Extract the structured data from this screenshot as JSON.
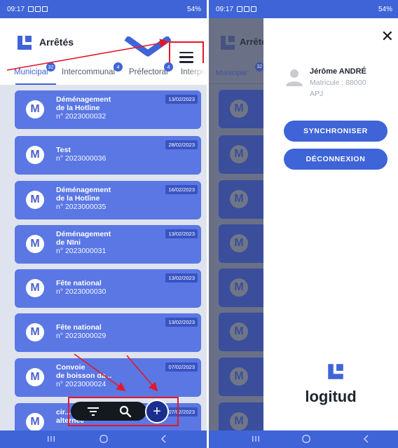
{
  "status_bar": {
    "time": "09:17",
    "battery": "54%"
  },
  "app": {
    "title": "Arrêtés",
    "menu_icon": "hamburger-menu-icon"
  },
  "tabs": [
    {
      "label": "Municipal",
      "badge": "32",
      "active": true
    },
    {
      "label": "Intercommunal",
      "badge": "4",
      "active": false
    },
    {
      "label": "Préfectoral",
      "badge": "4",
      "active": false
    },
    {
      "label": "Interpré",
      "badge": "",
      "active": false
    }
  ],
  "arretes": [
    {
      "avatar": "M",
      "title_line1": "Déménagement",
      "title_line2": "de la Hotline",
      "number": "n° 2023000032",
      "date": "13/02/2023"
    },
    {
      "avatar": "M",
      "title_line1": "Test",
      "title_line2": "",
      "number": "n° 2023000036",
      "date": "28/02/2023"
    },
    {
      "avatar": "M",
      "title_line1": "Déménagement",
      "title_line2": "de la Hotline",
      "number": "n° 2023000035",
      "date": "16/02/2023"
    },
    {
      "avatar": "M",
      "title_line1": "Déménagement",
      "title_line2": "de NIni",
      "number": "n° 2023000031",
      "date": "13/02/2023"
    },
    {
      "avatar": "M",
      "title_line1": "Fête national",
      "title_line2": "",
      "number": "n° 2023000030",
      "date": "13/02/2023"
    },
    {
      "avatar": "M",
      "title_line1": "Fête national",
      "title_line2": "",
      "number": "n° 2023000029",
      "date": "13/02/2023"
    },
    {
      "avatar": "M",
      "title_line1": "Convoie",
      "title_line2": "de boisson da...",
      "number": "n° 2023000024",
      "date": "07/02/2023"
    },
    {
      "avatar": "M",
      "title_line1": "cir...",
      "title_line2": "alternée",
      "number": "",
      "date": "07/02/2023"
    }
  ],
  "actions": {
    "filter_icon": "filter-icon",
    "search_icon": "search-icon",
    "add_icon": "plus-icon",
    "add_label": "+"
  },
  "drawer": {
    "close_label": "✕",
    "user_name": "Jérôme ANDRÉ",
    "user_matricule": "Matricule : 88000",
    "user_role": "APJ",
    "sync_label": "SYNCHRONISER",
    "logout_label": "DÉCONNEXION",
    "brand_name": "logitud"
  },
  "colors": {
    "primary": "#3f64d8",
    "card": "#5a77e4",
    "annotation": "#e2182a"
  }
}
